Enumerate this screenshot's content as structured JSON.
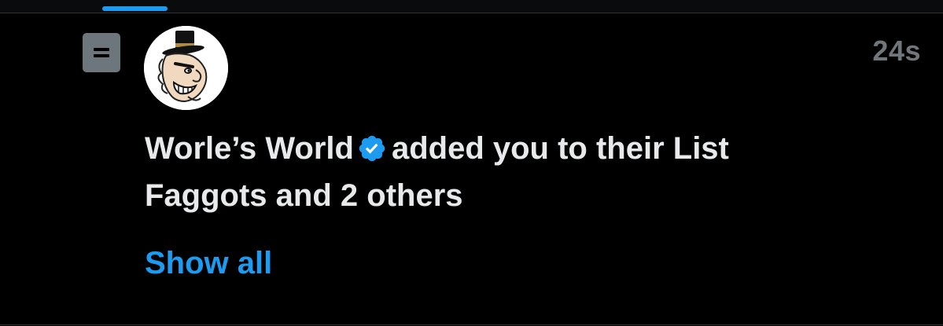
{
  "header": {
    "active_tab_color": "#1d9bf0"
  },
  "notification": {
    "type_icon": "list-icon",
    "avatar_icon": "avatar-demon-deacon",
    "timestamp": "24s",
    "actor_name": "Worle’s World",
    "verified_icon": "verified-badge-icon",
    "action_text": "added you to their List",
    "list_name": "Faggots",
    "others_text": "and 2 others",
    "show_all_label": "Show all"
  },
  "colors": {
    "background": "#000000",
    "text_primary": "#e7e9ea",
    "text_secondary": "#71767b",
    "accent": "#1d9bf0"
  }
}
